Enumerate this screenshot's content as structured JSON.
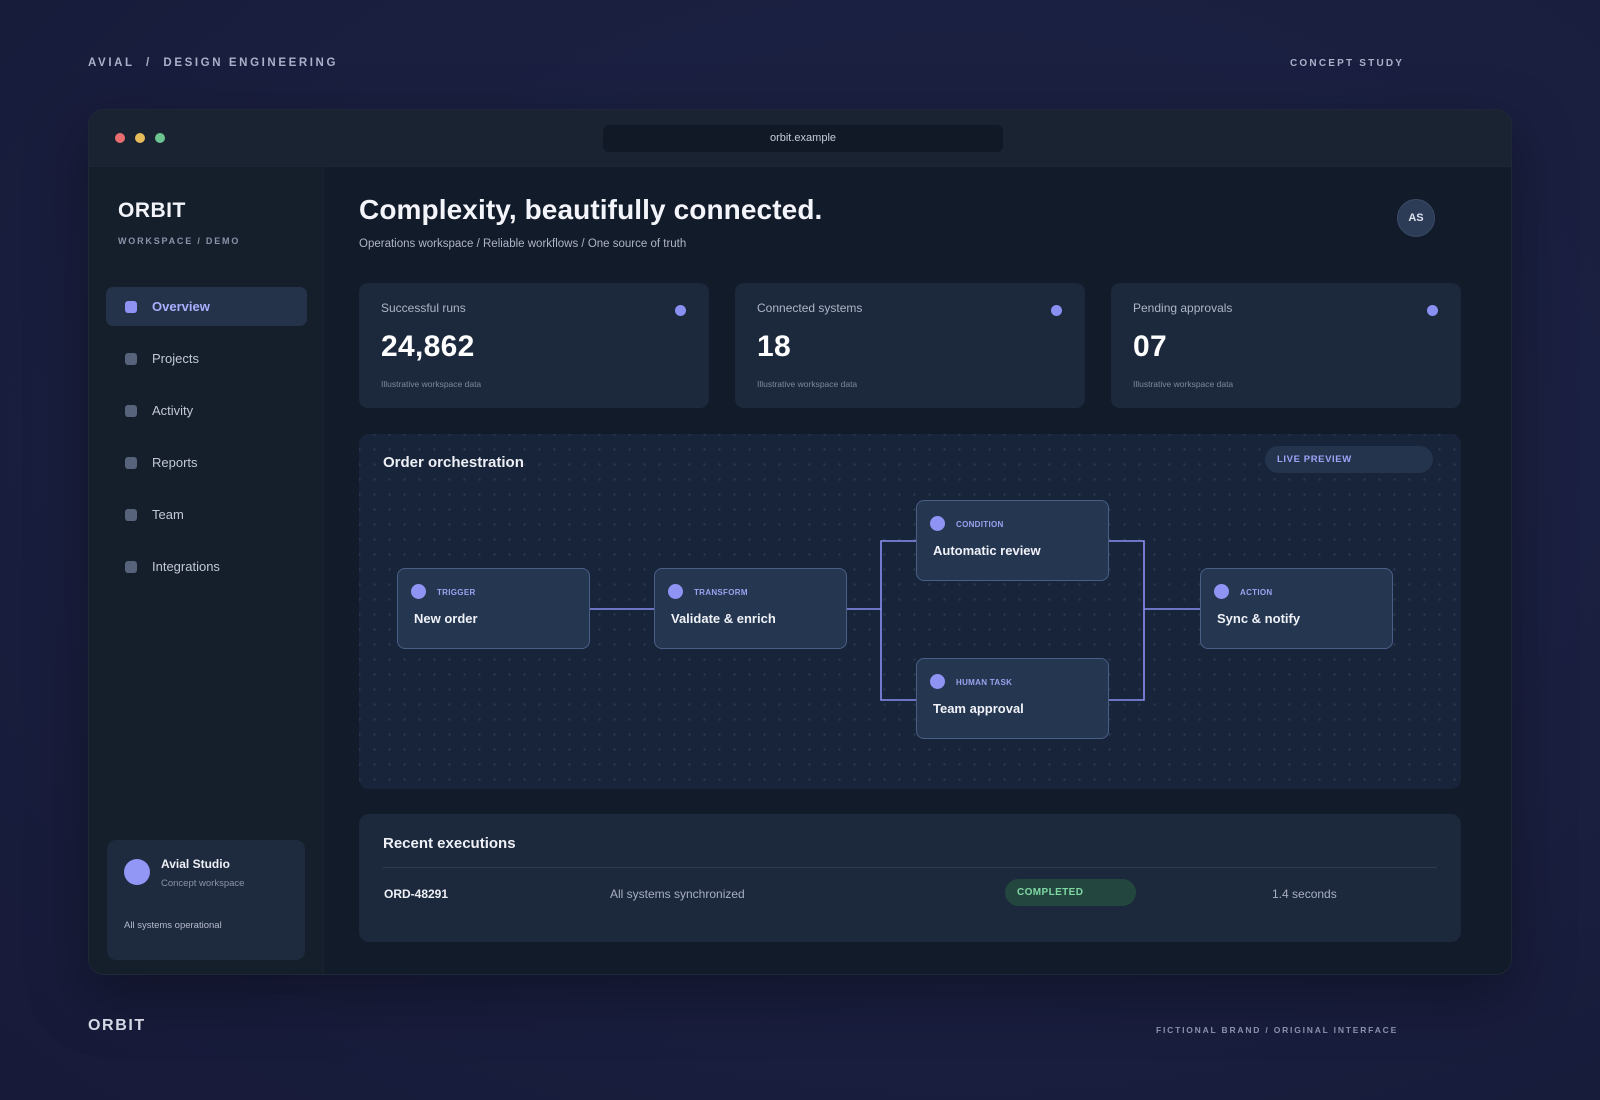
{
  "page": {
    "top_left": "AVIAL  /  DESIGN ENGINEERING",
    "top_right": "CONCEPT STUDY",
    "footer_brand": "ORBIT",
    "footer_note": "FICTIONAL BRAND / ORIGINAL INTERFACE"
  },
  "window": {
    "url": "orbit.example"
  },
  "sidebar": {
    "brand": "ORBIT",
    "brand_sub": "WORKSPACE / DEMO",
    "items": [
      {
        "label": "Overview",
        "active": true
      },
      {
        "label": "Projects",
        "active": false
      },
      {
        "label": "Activity",
        "active": false
      },
      {
        "label": "Reports",
        "active": false
      },
      {
        "label": "Team",
        "active": false
      },
      {
        "label": "Integrations",
        "active": false
      }
    ],
    "studio": {
      "name": "Avial Studio",
      "subtitle": "Concept workspace",
      "status": "All systems operational"
    }
  },
  "header": {
    "title": "Complexity, beautifully connected.",
    "subtitle": "Operations workspace / Reliable workflows / One source of truth",
    "avatar_initials": "AS"
  },
  "stats": [
    {
      "label": "Successful runs",
      "value": "24,862",
      "note": "Illustrative workspace data"
    },
    {
      "label": "Connected systems",
      "value": "18",
      "note": "Illustrative workspace data"
    },
    {
      "label": "Pending approvals",
      "value": "07",
      "note": "Illustrative workspace data"
    }
  ],
  "flow": {
    "title": "Order orchestration",
    "badge": "LIVE PREVIEW",
    "nodes": [
      {
        "type": "TRIGGER",
        "title": "New order"
      },
      {
        "type": "TRANSFORM",
        "title": "Validate & enrich"
      },
      {
        "type": "CONDITION",
        "title": "Automatic review"
      },
      {
        "type": "HUMAN TASK",
        "title": "Team approval"
      },
      {
        "type": "ACTION",
        "title": "Sync & notify"
      }
    ]
  },
  "executions": {
    "title": "Recent executions",
    "rows": [
      {
        "id": "ORD-48291",
        "description": "All systems synchronized",
        "status": "COMPLETED",
        "duration": "1.4 seconds"
      }
    ]
  },
  "colors": {
    "accent": "#8f93f3",
    "success": "#7fd7a4",
    "background": "#1a1f40",
    "panel": "#1c293c"
  }
}
